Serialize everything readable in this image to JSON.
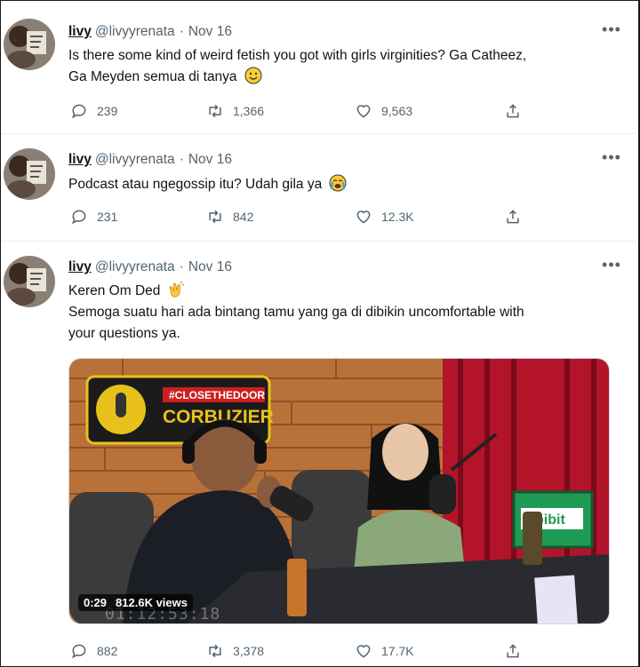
{
  "tweets": [
    {
      "display_name": "livy",
      "handle": "@livyyrenata",
      "separator": "·",
      "date": "Nov 16",
      "text_lines": [
        "Is there some kind of weird fetish you got with girls virginities? Ga Catheez,",
        "Ga Meyden semua di tanya"
      ],
      "emoji": "slightly-smiling-face",
      "replies": "239",
      "retweets": "1,366",
      "likes": "9,563"
    },
    {
      "display_name": "livy",
      "handle": "@livyyrenata",
      "separator": "·",
      "date": "Nov 16",
      "text_lines": [
        "Podcast atau ngegossip itu? Udah gila ya"
      ],
      "emoji": "loudly-crying-face",
      "replies": "231",
      "retweets": "842",
      "likes": "12.3K"
    },
    {
      "display_name": "livy",
      "handle": "@livyyrenata",
      "separator": "·",
      "date": "Nov 16",
      "text_lines": [
        "Keren Om Ded",
        "Semoga suatu hari ada bintang tamu yang ga di dibikin uncomfortable with",
        "your questions ya."
      ],
      "emoji": "clapping-hands",
      "replies": "882",
      "retweets": "3,378",
      "likes": "17.7K",
      "video": {
        "duration": "0:29",
        "views": "812.6K views",
        "sign_top": "#CLOSETHEDOOR",
        "sign_main": "CORBUZIER",
        "screen_label": "bibit",
        "timestamp_overlay": "01:12:53:18"
      }
    }
  ],
  "icons": {
    "more": "more-horizontal-icon",
    "reply": "reply-icon",
    "retweet": "retweet-icon",
    "like": "heart-icon",
    "share": "share-icon"
  },
  "colors": {
    "text": "#0f1419",
    "muted": "#536471",
    "divider": "#e6ecf0"
  }
}
